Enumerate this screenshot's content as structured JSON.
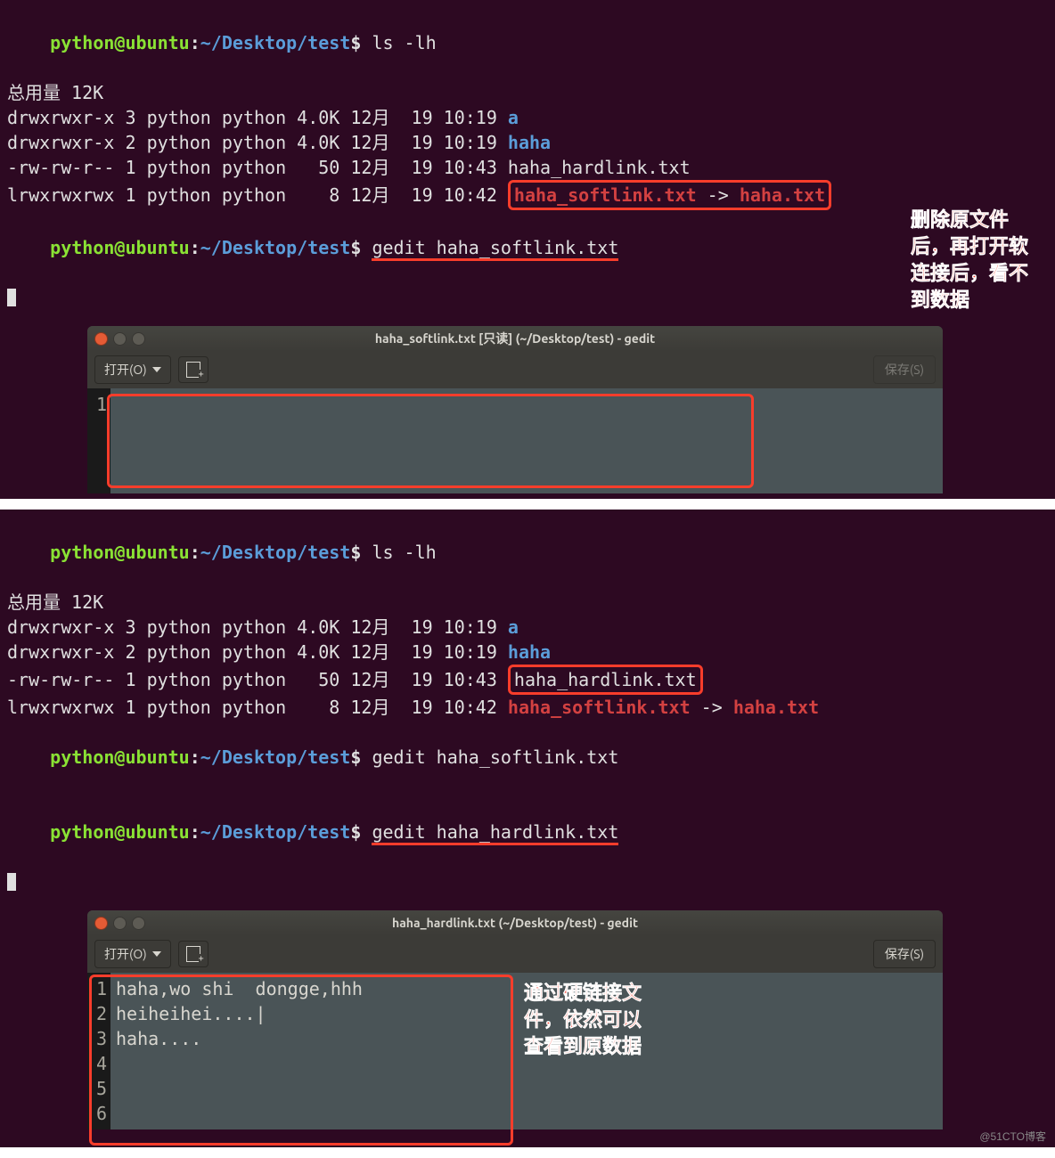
{
  "terminal1": {
    "prompt_user": "python@ubuntu",
    "prompt_sep": ":",
    "prompt_path": "~/Desktop/test",
    "prompt_dollar": "$",
    "cmd1": "ls -lh",
    "total": "总用量 12K",
    "rows": [
      {
        "perm": "drwxrwxr-x",
        "links": "3",
        "owner": "python",
        "group": "python",
        "size": "4.0K",
        "date": "12月  19 10:19",
        "name": "a",
        "class": "dir"
      },
      {
        "perm": "drwxrwxr-x",
        "links": "2",
        "owner": "python",
        "group": "python",
        "size": "4.0K",
        "date": "12月  19 10:19",
        "name": "haha",
        "class": "dir"
      },
      {
        "perm": "-rw-rw-r--",
        "links": "1",
        "owner": "python",
        "group": "python",
        "size": "  50",
        "date": "12月  19 10:43",
        "name": "haha_hardlink.txt",
        "class": "plain"
      },
      {
        "perm": "lrwxrwxrwx",
        "links": "1",
        "owner": "python",
        "group": "python",
        "size": "   8",
        "date": "12月  19 10:42",
        "name": "haha_softlink.txt",
        "arrow": "->",
        "target": "haha.txt",
        "class": "symlink"
      }
    ],
    "cmd2": "gedit haha_softlink.txt"
  },
  "gedit1": {
    "title": "haha_softlink.txt [只读] (~/Desktop/test) - gedit",
    "open_label": "打开(O)",
    "save_label": "保存(S)",
    "lines": [
      "1"
    ],
    "content": [
      ""
    ]
  },
  "annotation1": {
    "l1": "删除原文件",
    "l2": "后，再打开软",
    "l3": "连接后，看不",
    "l4": "到数据"
  },
  "terminal2": {
    "cmd1": "ls -lh",
    "total": "总用量 12K",
    "rows": [
      {
        "perm": "drwxrwxr-x",
        "links": "3",
        "owner": "python",
        "group": "python",
        "size": "4.0K",
        "date": "12月  19 10:19",
        "name": "a",
        "class": "dir"
      },
      {
        "perm": "drwxrwxr-x",
        "links": "2",
        "owner": "python",
        "group": "python",
        "size": "4.0K",
        "date": "12月  19 10:19",
        "name": "haha",
        "class": "dir"
      },
      {
        "perm": "-rw-rw-r--",
        "links": "1",
        "owner": "python",
        "group": "python",
        "size": "  50",
        "date": "12月  19 10:43",
        "name": "haha_hardlink.txt",
        "class": "plain"
      },
      {
        "perm": "lrwxrwxrwx",
        "links": "1",
        "owner": "python",
        "group": "python",
        "size": "   8",
        "date": "12月  19 10:42",
        "name": "haha_softlink.txt",
        "arrow": "->",
        "target": "haha.txt",
        "class": "symlink"
      }
    ],
    "cmd2": "gedit haha_softlink.txt",
    "cmd3": "gedit haha_hardlink.txt"
  },
  "gedit2": {
    "title": "haha_hardlink.txt (~/Desktop/test) - gedit",
    "open_label": "打开(O)",
    "save_label": "保存(S)",
    "lines": [
      "1",
      "2",
      "3",
      "4",
      "5",
      "6"
    ],
    "content": [
      "haha,wo shi  dongge,hhh",
      "",
      "heiheihei....|",
      "",
      "",
      "haha...."
    ]
  },
  "annotation2": {
    "l1": "通过硬链接文",
    "l2": "件，依然可以",
    "l3": "查看到原数据"
  },
  "watermark": "@51CTO博客"
}
